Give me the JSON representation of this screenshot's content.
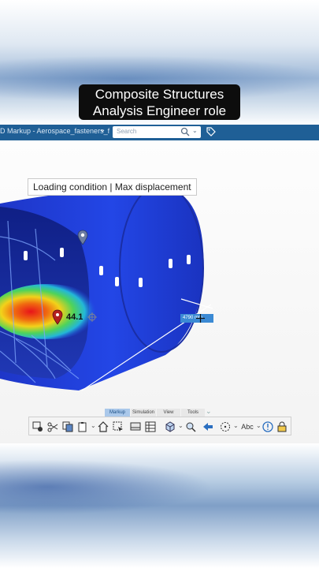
{
  "caption": {
    "line1": "Composite Structures",
    "line2": "Analysis Engineer role"
  },
  "app_bar": {
    "title": "D Markup - Aerospace_fasteners_f",
    "search_placeholder": "Search"
  },
  "viewport": {
    "loading_label": "Loading condition | Max displacement",
    "probe_value": "44.1",
    "dimension_value": "4790 mm"
  },
  "toolbar": {
    "tabs": [
      "Markup",
      "Simulation",
      "View",
      "Tools"
    ],
    "active_tab": "Markup",
    "text_tool_label": "Abc"
  },
  "colors": {
    "accent": "#1f5f96",
    "result_blue": "#1f3fd9",
    "hot_red": "#e21a1a"
  }
}
